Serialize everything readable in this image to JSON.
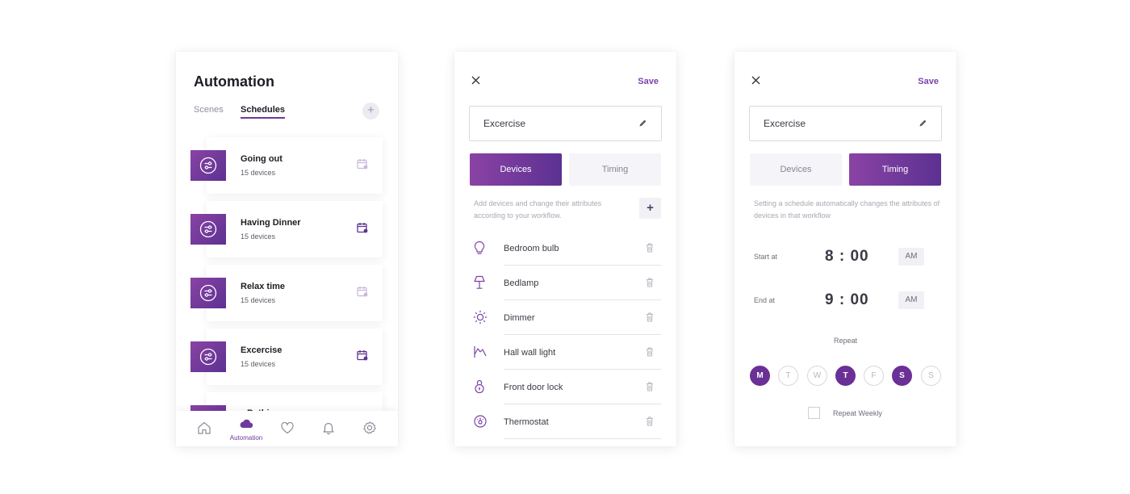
{
  "automation": {
    "title": "Automation",
    "tabs": [
      {
        "label": "Scenes",
        "active": false
      },
      {
        "label": "Schedules",
        "active": true
      }
    ],
    "add_label": "+",
    "schedules": [
      {
        "name": "Going out",
        "count": "15 devices",
        "calendar_active": false
      },
      {
        "name": "Having Dinner",
        "count": "15 devices",
        "calendar_active": true
      },
      {
        "name": "Relax time",
        "count": "15 devices",
        "calendar_active": false
      },
      {
        "name": "Excercise",
        "count": "15 devices",
        "calendar_active": true
      },
      {
        "name": "Bathing",
        "count": "",
        "calendar_active": false
      }
    ],
    "nav": [
      {
        "icon": "home-icon",
        "label": ""
      },
      {
        "icon": "cloud-icon",
        "label": "Automation",
        "active": true
      },
      {
        "icon": "heart-icon",
        "label": ""
      },
      {
        "icon": "bell-icon",
        "label": ""
      },
      {
        "icon": "gear-icon",
        "label": ""
      }
    ]
  },
  "devices_screen": {
    "save_label": "Save",
    "name_value": "Excercise",
    "segment": {
      "devices_label": "Devices",
      "timing_label": "Timing",
      "active": "devices"
    },
    "hint": "Add devices and change their attributes according to your workflow.",
    "add_label": "+",
    "devices": [
      {
        "name": "Bedroom bulb",
        "icon": "bulb-icon"
      },
      {
        "name": "Bedlamp",
        "icon": "lamp-icon"
      },
      {
        "name": "Dimmer",
        "icon": "sun-icon"
      },
      {
        "name": "Hall wall light",
        "icon": "wall-light-icon"
      },
      {
        "name": "Front door lock",
        "icon": "lock-icon"
      },
      {
        "name": "Thermostat",
        "icon": "thermostat-icon"
      }
    ]
  },
  "timing_screen": {
    "save_label": "Save",
    "name_value": "Excercise",
    "segment": {
      "devices_label": "Devices",
      "timing_label": "Timing",
      "active": "timing"
    },
    "hint": "Setting a schedule automatically changes the attributes of devices in that workflow",
    "start": {
      "label": "Start at",
      "time": "8 : 00",
      "ampm": "AM"
    },
    "end": {
      "label": "End at",
      "time": "9 : 00",
      "ampm": "AM"
    },
    "repeat_label": "Repeat",
    "days": [
      {
        "letter": "M",
        "selected": true
      },
      {
        "letter": "T",
        "selected": false
      },
      {
        "letter": "W",
        "selected": false
      },
      {
        "letter": "T",
        "selected": true
      },
      {
        "letter": "F",
        "selected": false
      },
      {
        "letter": "S",
        "selected": true
      },
      {
        "letter": "S",
        "selected": false
      }
    ],
    "repeat_weekly_label": "Repeat Weekly",
    "repeat_weekly_checked": false
  },
  "colors": {
    "accent": "#6c3a9e",
    "gradient_start": "#8a43a4",
    "gradient_end": "#5c3192"
  }
}
